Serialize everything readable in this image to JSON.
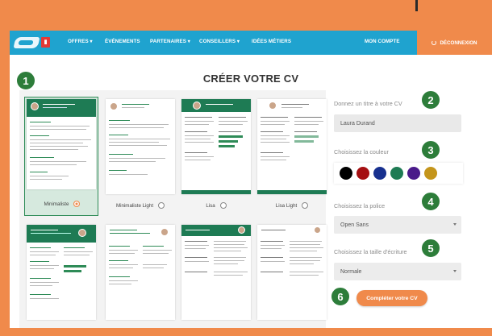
{
  "nav": {
    "items": [
      "OFFRES ▾",
      "ÉVÉNEMENTS",
      "PARTENAIRES ▾",
      "CONSEILLERS ▾",
      "IDÉES MÉTIERS"
    ],
    "account": "MON COMPTE",
    "logout": "DÉCONNEXION"
  },
  "page": {
    "title": "CRÉER VOTRE CV"
  },
  "templates": [
    {
      "label": "Minimaliste",
      "selected": true
    },
    {
      "label": "Minimaliste Light",
      "selected": false
    },
    {
      "label": "Lisa",
      "selected": false
    },
    {
      "label": "Lisa Light",
      "selected": false
    },
    {
      "label": "",
      "selected": false
    },
    {
      "label": "",
      "selected": false
    },
    {
      "label": "",
      "selected": false
    },
    {
      "label": "",
      "selected": false
    }
  ],
  "thumb_text": {
    "name1": "HÉLÈNE MARCEAU",
    "name2": "HÉLÈNE MARCEAU"
  },
  "form": {
    "title_label": "Donnez un titre à votre CV",
    "title_value": "Laura Durand",
    "color_label": "Choisissez la couleur",
    "colors": [
      "#000000",
      "#a50f12",
      "#17308f",
      "#1e7b54",
      "#4a1a8a",
      "#c4951b"
    ],
    "font_label": "Choisissez la police",
    "font_value": "Open Sans",
    "size_label": "Choisissez la taille d'écriture",
    "size_value": "Normale",
    "submit": "Compléter votre CV"
  },
  "badges": [
    "1",
    "2",
    "3",
    "4",
    "5",
    "6"
  ]
}
